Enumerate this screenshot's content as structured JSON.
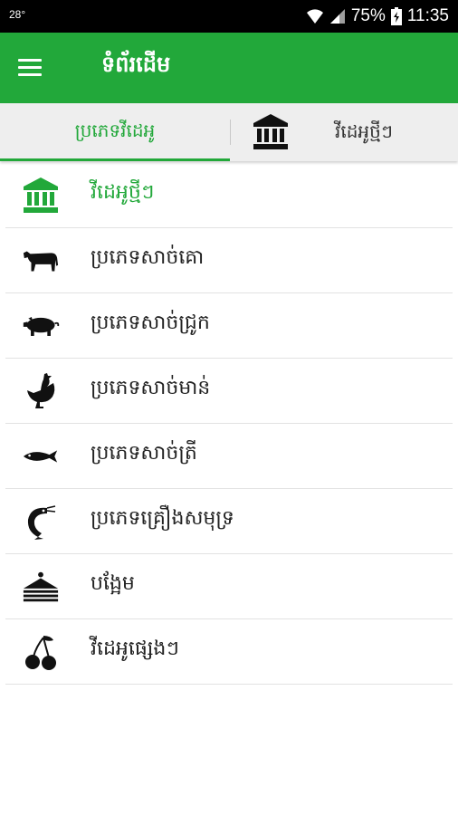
{
  "status_bar": {
    "temperature": "28°",
    "battery": "75%",
    "time": "11:35"
  },
  "app_bar": {
    "title": "ទំព័រដើម",
    "menu_icon": "hamburger-menu-icon"
  },
  "tabs": [
    {
      "label": "ប្រភេទវីដេអូ",
      "selected": true
    },
    {
      "label": "វីដេអូថ្មីៗ",
      "icon": "museum-icon",
      "selected": false
    }
  ],
  "menu": {
    "items": [
      {
        "label": "វីដេអូថ្មីៗ",
        "icon": "museum-icon",
        "active": true
      },
      {
        "label": "ប្រភេទសាច់គោ",
        "icon": "cow-icon"
      },
      {
        "label": "ប្រភេទសាច់ជ្រូក",
        "icon": "pig-icon"
      },
      {
        "label": "ប្រភេទសាច់មាន់",
        "icon": "chicken-icon"
      },
      {
        "label": "ប្រភេទសាច់ត្រី",
        "icon": "fish-icon"
      },
      {
        "label": "ប្រភេទគ្រឿងសមុទ្រ",
        "icon": "shrimp-icon"
      },
      {
        "label": "បង្អែម",
        "icon": "cake-icon"
      },
      {
        "label": "វីដេអូផ្សេងៗ",
        "icon": "cherry-icon"
      }
    ]
  },
  "colors": {
    "primary": "#22a83a",
    "tab_background": "#eeeeee",
    "divider": "#e2e2e2"
  }
}
